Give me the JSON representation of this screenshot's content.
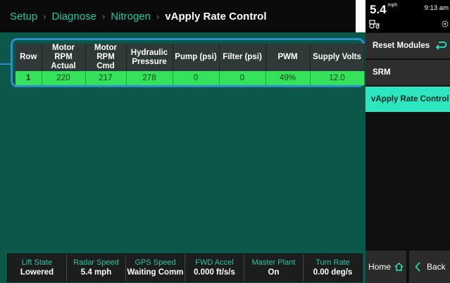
{
  "breadcrumb": {
    "items": [
      "Setup",
      "Diagnose",
      "Nitrogen"
    ],
    "current": "vApply Rate Control",
    "separator": "›"
  },
  "table": {
    "headers": [
      "Row",
      "Motor RPM Actual",
      "Motor RPM Cmd",
      "Hydraulic Pressure",
      "Pump (psi)",
      "Filter (psi)",
      "PWM",
      "Supply Volts"
    ],
    "rows": [
      [
        "1",
        "220",
        "217",
        "278",
        "0",
        "0",
        "49%",
        "12.0"
      ]
    ]
  },
  "status_bar": [
    {
      "label": "Lift State",
      "value": "Lowered"
    },
    {
      "label": "Radar Speed",
      "value": "5.4 mph"
    },
    {
      "label": "GPS Speed",
      "value": "Waiting Comm"
    },
    {
      "label": "FWD Accel",
      "value": "0.000 ft/s/s"
    },
    {
      "label": "Master Plant",
      "value": "On"
    },
    {
      "label": "Turn Rate",
      "value": "0.00 deg/s"
    }
  ],
  "top_info": {
    "speed": "5.4",
    "speed_unit": "mph",
    "time": "9:13 am"
  },
  "side_menu": {
    "reset": "Reset Modules",
    "srm": "SRM",
    "vapply": "vApply Rate Control"
  },
  "nav": {
    "home": "Home",
    "back": "Back"
  },
  "colors": {
    "accent": "#26c6a5",
    "panel": "#0b584a",
    "row_ok": "#35e35a",
    "selection": "#2c8fc9",
    "active_button": "#2ce6c0"
  },
  "icons": {
    "tractor": "tractor-icon",
    "gps": "gps-signal-icon",
    "reset": "return-arrow-icon",
    "home": "home-icon",
    "back": "chevron-left-icon"
  }
}
